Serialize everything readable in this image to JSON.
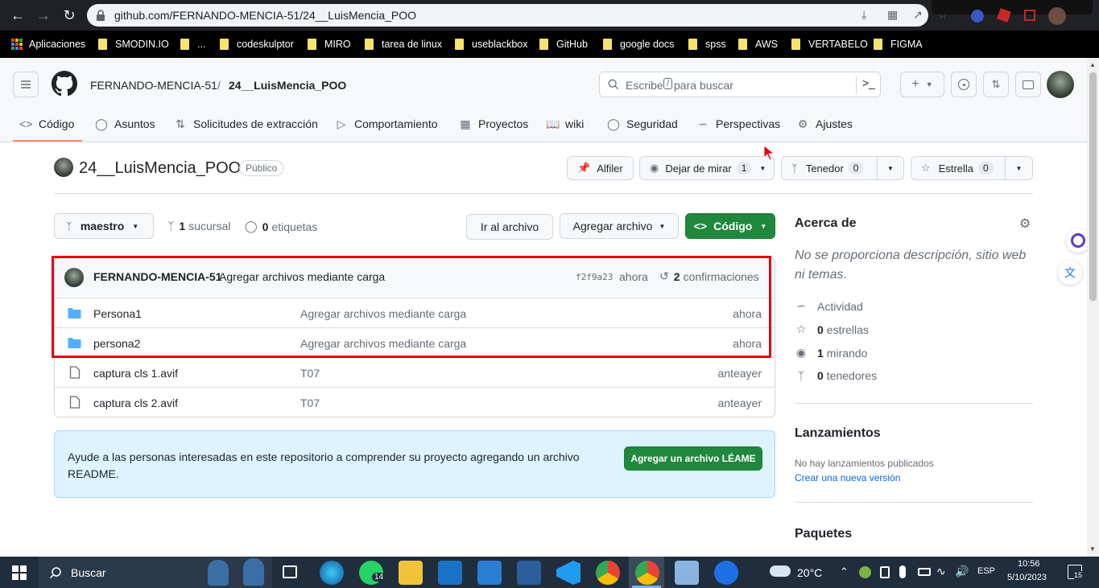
{
  "browser": {
    "url": "github.com/FERNANDO-MENCIA-51/24__LuisMencia_POO",
    "bookmarks": [
      "Aplicaciones",
      "SMODIN.IO",
      "...",
      "codeskulptor",
      "MIRO",
      "tarea de linux",
      "useblackbox",
      "GitHub",
      "google docs",
      "spss",
      "AWS",
      "VERTABELO",
      "FIGMA"
    ]
  },
  "header": {
    "owner": "FERNANDO-MENCIA-51",
    "separator": "/",
    "repo": "24__LuisMencia_POO",
    "search_placeholder_a": "Escribe",
    "search_key": "/",
    "search_placeholder_b": "para buscar"
  },
  "tabs": [
    {
      "label": "Código",
      "icon": "code-icon"
    },
    {
      "label": "Asuntos",
      "icon": "issue-icon"
    },
    {
      "label": "Solicitudes de extracción",
      "icon": "pull-request-icon"
    },
    {
      "label": "Comportamiento",
      "icon": "play-icon"
    },
    {
      "label": "Proyectos",
      "icon": "table-icon"
    },
    {
      "label": "wiki",
      "icon": "book-icon"
    },
    {
      "label": "Seguridad",
      "icon": "shield-icon"
    },
    {
      "label": "Perspectivas",
      "icon": "graph-icon"
    },
    {
      "label": "Ajustes",
      "icon": "gear-icon"
    }
  ],
  "repo_header": {
    "title": "24__LuisMencia_POO",
    "visibility": "Público",
    "pin_label": "Alfiler",
    "watch_label": "Dejar de mirar",
    "watch_count": "1",
    "fork_label": "Tenedor",
    "fork_count": "0",
    "star_label": "Estrella",
    "star_count": "0"
  },
  "toolbar": {
    "branch": "maestro",
    "branches_count": "1",
    "branches_label": "sucursal",
    "tags_count": "0",
    "tags_label": "etiquetas",
    "goto_file": "Ir al archivo",
    "add_file": "Agregar archivo",
    "code": "Código"
  },
  "commit": {
    "author": "FERNANDO-MENCIA-51",
    "message": "Agregar archivos mediante carga",
    "sha": "f2f9a23",
    "time": "ahora",
    "count": "2",
    "count_label": "confirmaciones"
  },
  "files": [
    {
      "name": "Persona1",
      "type": "folder",
      "message": "Agregar archivos mediante carga",
      "age": "ahora"
    },
    {
      "name": "persona2",
      "type": "folder",
      "message": "Agregar archivos mediante carga",
      "age": "ahora"
    },
    {
      "name": "captura cls 1.avif",
      "type": "file",
      "message": "T07",
      "age": "anteayer"
    },
    {
      "name": "captura cls 2.avif",
      "type": "file",
      "message": "T07",
      "age": "anteayer"
    }
  ],
  "readme_banner": {
    "text": "Ayude a las personas interesadas en este repositorio a comprender su proyecto agregando un archivo README.",
    "button": "Agregar un archivo LÉAME"
  },
  "about": {
    "title": "Acerca de",
    "description": "No se proporciona descripción, sitio web ni temas.",
    "activity": "Actividad",
    "stars_count": "0",
    "stars_label": "estrellas",
    "watching_count": "1",
    "watching_label": "mirando",
    "forks_count": "0",
    "forks_label": "tenedores"
  },
  "releases": {
    "title": "Lanzamientos",
    "none": "No hay lanzamientos publicados",
    "create_link": "Crear una nueva versión"
  },
  "packages": {
    "title": "Paquetes"
  },
  "taskbar": {
    "search": "Buscar",
    "whatsapp_badge": "14",
    "weather": "20°C",
    "lang": "ESP",
    "time": "10:56",
    "date": "5/10/2023",
    "notif_count": "15"
  },
  "colors": {
    "accent_green": "#1f883d",
    "highlight_red": "#e3000f",
    "folder_blue": "#54aeff",
    "link": "#0969da"
  }
}
